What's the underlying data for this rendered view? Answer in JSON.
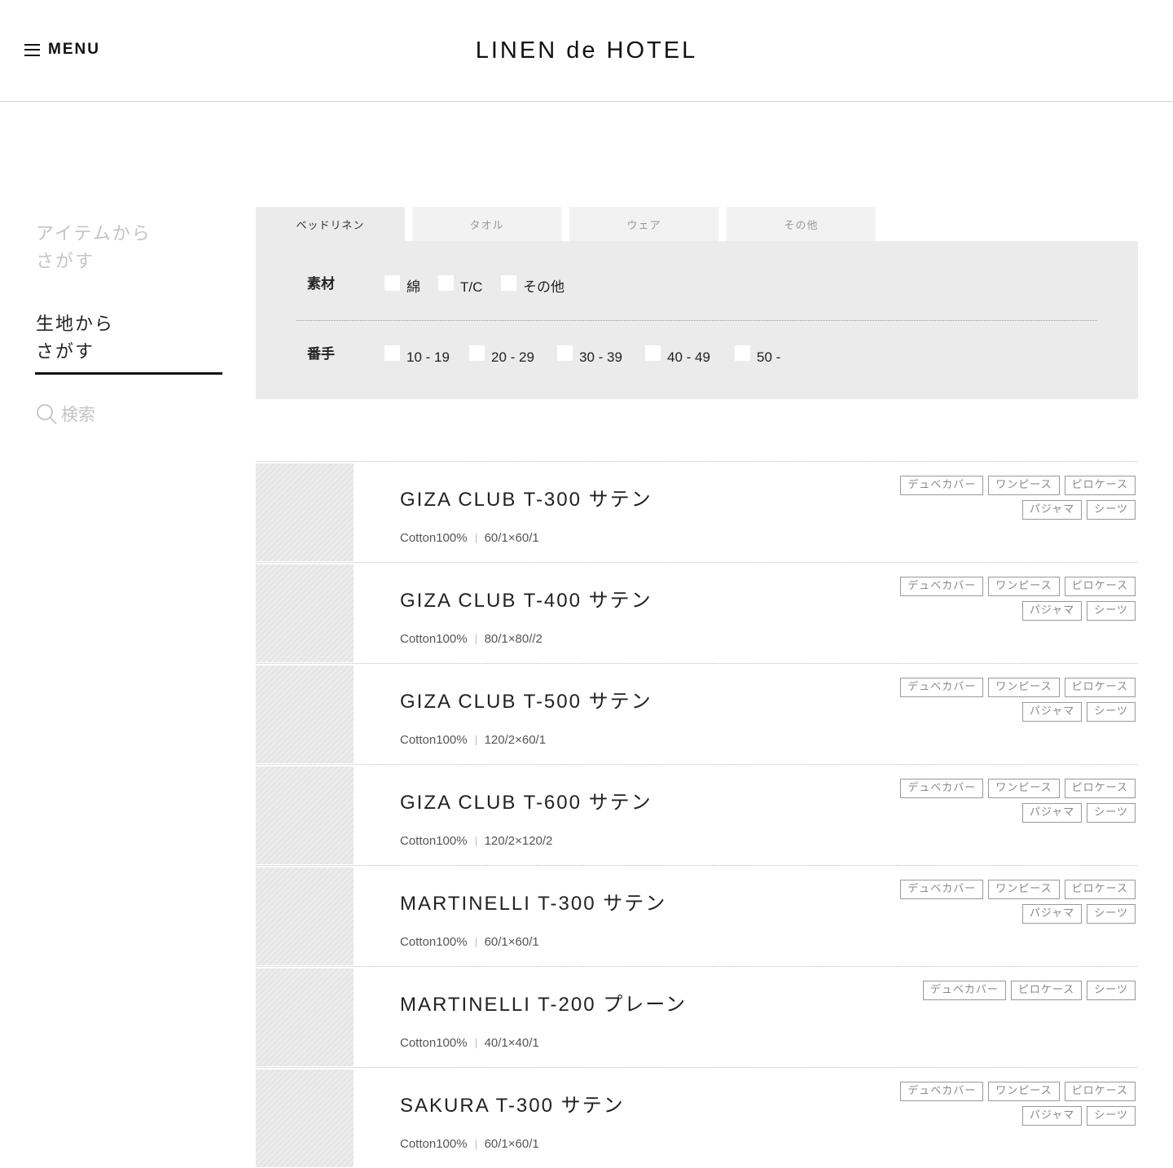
{
  "header": {
    "menu_label": "MENU",
    "logo": "LINEN de HOTEL"
  },
  "sidebar": {
    "item_search_label": "アイテムから\nさがす",
    "fabric_search_label": "生地から\nさがす",
    "keyword_search_label": "検索"
  },
  "tabs": [
    {
      "label": "ベッドリネン",
      "active": true
    },
    {
      "label": "タオル",
      "active": false
    },
    {
      "label": "ウェア",
      "active": false
    },
    {
      "label": "その他",
      "active": false
    }
  ],
  "filters": {
    "material": {
      "label": "素材",
      "options": [
        "綿",
        "T/C",
        "その他"
      ]
    },
    "count": {
      "label": "番手",
      "options": [
        "10 - 19",
        "20 - 29",
        "30 - 39",
        "40 - 49",
        "50 -"
      ]
    }
  },
  "products": [
    {
      "name": "GIZA CLUB T-300 サテン",
      "material": "Cotton100%",
      "yarn": "60/1×60/1",
      "tags": [
        "デュベカバー",
        "ワンピース",
        "ピロケース",
        "パジャマ",
        "シーツ"
      ]
    },
    {
      "name": "GIZA CLUB T-400 サテン",
      "material": "Cotton100%",
      "yarn": "80/1×80//2",
      "tags": [
        "デュベカバー",
        "ワンピース",
        "ピロケース",
        "パジャマ",
        "シーツ"
      ]
    },
    {
      "name": "GIZA CLUB T-500 サテン",
      "material": "Cotton100%",
      "yarn": "120/2×60/1",
      "tags": [
        "デュベカバー",
        "ワンピース",
        "ピロケース",
        "パジャマ",
        "シーツ"
      ]
    },
    {
      "name": "GIZA CLUB T-600 サテン",
      "material": "Cotton100%",
      "yarn": "120/2×120/2",
      "tags": [
        "デュベカバー",
        "ワンピース",
        "ピロケース",
        "パジャマ",
        "シーツ"
      ]
    },
    {
      "name": "MARTINELLI T-300 サテン",
      "material": "Cotton100%",
      "yarn": "60/1×60/1",
      "tags": [
        "デュベカバー",
        "ワンピース",
        "ピロケース",
        "パジャマ",
        "シーツ"
      ]
    },
    {
      "name": "MARTINELLI T-200 プレーン",
      "material": "Cotton100%",
      "yarn": "40/1×40/1",
      "tags": [
        "デュベカバー",
        "ピロケース",
        "シーツ"
      ]
    },
    {
      "name": "SAKURA T-300 サテン",
      "material": "Cotton100%",
      "yarn": "60/1×60/1",
      "tags": [
        "デュベカバー",
        "ワンピース",
        "ピロケース",
        "パジャマ",
        "シーツ"
      ]
    }
  ]
}
